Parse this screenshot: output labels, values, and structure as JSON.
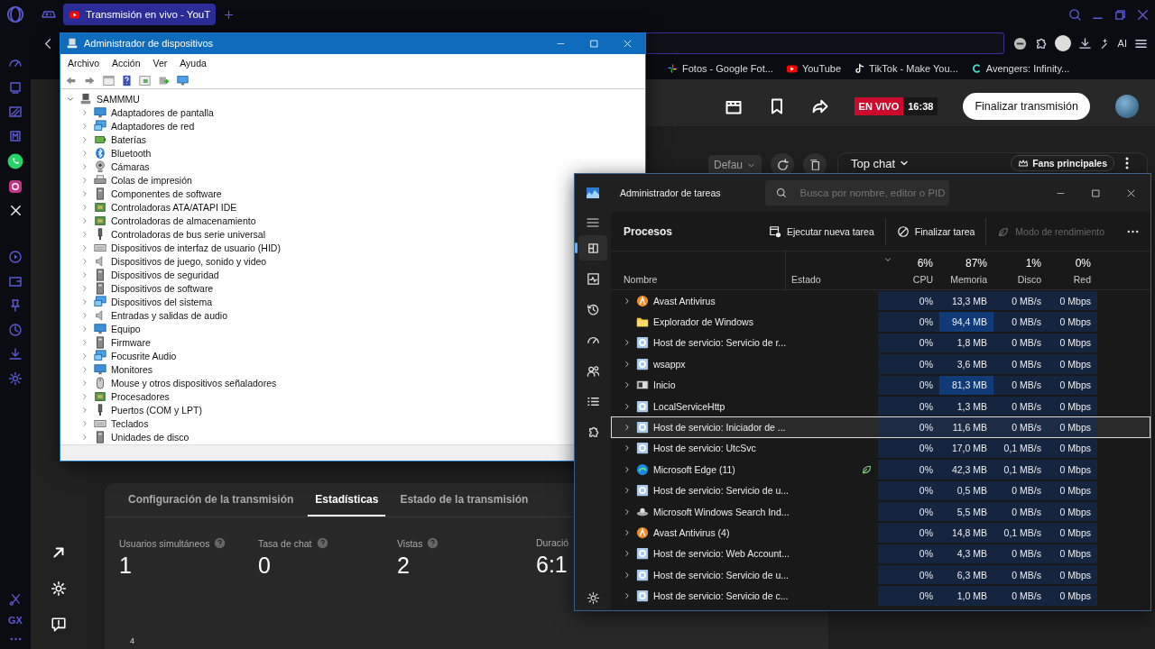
{
  "browser": {
    "tabs": [
      {
        "label": "Transmisión en vivo - YouT",
        "selected": true
      }
    ],
    "bookmarks": [
      {
        "label": "Fotos - Google Fot...",
        "kind": "photos"
      },
      {
        "label": "YouTube",
        "kind": "video"
      },
      {
        "label": "TikTok - Make You...",
        "kind": "note"
      },
      {
        "label": "Avengers: Infinity...",
        "kind": "letter"
      }
    ],
    "ai_label": "AI",
    "sidebar_label": "GX"
  },
  "studio": {
    "live_badge": "EN VIVO",
    "live_time": "16:38",
    "end_button": "Finalizar transmisión",
    "preview_select": "Defau",
    "chat_mode": "Top chat",
    "chat_filter": "Fans principales",
    "tabs": [
      {
        "label": "Configuración de la transmisión",
        "selected": false
      },
      {
        "label": "Estadísticas",
        "selected": true
      },
      {
        "label": "Estado de la transmisión",
        "selected": false
      }
    ],
    "stats": [
      {
        "label": "Usuarios simultáneos",
        "value": "1",
        "help": true
      },
      {
        "label": "Tasa de chat",
        "value": "0",
        "help": true
      },
      {
        "label": "Vistas",
        "value": "2",
        "help": true
      },
      {
        "label": "Duració",
        "value": "6:1",
        "help": false
      }
    ],
    "chart_tick": "4"
  },
  "device_manager": {
    "title": "Administrador de dispositivos",
    "menu": [
      "Archivo",
      "Acción",
      "Ver",
      "Ayuda"
    ],
    "tree": {
      "label": "SAMMMU",
      "expanded": true,
      "children": [
        {
          "label": "Adaptadores de pantalla",
          "kind": "monitor",
          "expanded": false
        },
        {
          "label": "Adaptadores de red",
          "kind": "network",
          "expanded": false
        },
        {
          "label": "Baterías",
          "kind": "battery",
          "expanded": false
        },
        {
          "label": "Bluetooth",
          "kind": "bluetooth",
          "expanded": false
        },
        {
          "label": "Cámaras",
          "kind": "camera",
          "expanded": false
        },
        {
          "label": "Colas de impresión",
          "kind": "printer",
          "expanded": false
        },
        {
          "label": "Componentes de software",
          "kind": "box",
          "expanded": false
        },
        {
          "label": "Controladoras ATA/ATAPI IDE",
          "kind": "chip",
          "expanded": false
        },
        {
          "label": "Controladoras de almacenamiento",
          "kind": "chip",
          "expanded": false
        },
        {
          "label": "Controladoras de bus serie universal",
          "kind": "plug",
          "expanded": false
        },
        {
          "label": "Dispositivos de interfaz de usuario (HID)",
          "kind": "keyboard",
          "expanded": false
        },
        {
          "label": "Dispositivos de juego, sonido y video",
          "kind": "speaker",
          "expanded": false
        },
        {
          "label": "Dispositivos de seguridad",
          "kind": "box",
          "expanded": false
        },
        {
          "label": "Dispositivos de software",
          "kind": "box",
          "expanded": false
        },
        {
          "label": "Dispositivos del sistema",
          "kind": "network",
          "expanded": false
        },
        {
          "label": "Entradas y salidas de audio",
          "kind": "speaker",
          "expanded": false
        },
        {
          "label": "Equipo",
          "kind": "monitor",
          "expanded": false
        },
        {
          "label": "Firmware",
          "kind": "box",
          "expanded": false
        },
        {
          "label": "Focusrite Audio",
          "kind": "network",
          "expanded": false
        },
        {
          "label": "Monitores",
          "kind": "monitor",
          "expanded": false
        },
        {
          "label": "Mouse y otros dispositivos señaladores",
          "kind": "mouse",
          "expanded": false
        },
        {
          "label": "Procesadores",
          "kind": "chip",
          "expanded": false
        },
        {
          "label": "Puertos (COM y LPT)",
          "kind": "plug",
          "expanded": false
        },
        {
          "label": "Teclados",
          "kind": "keyboard",
          "expanded": false
        },
        {
          "label": "Unidades de disco",
          "kind": "box",
          "expanded": false
        }
      ]
    }
  },
  "task_manager": {
    "title": "Administrador de tareas",
    "search": {
      "placeholder": "Busca por nombre, editor o PID"
    },
    "nav": [
      {
        "kind": "processes",
        "selected": true
      },
      {
        "kind": "performance",
        "selected": false
      },
      {
        "kind": "history",
        "selected": false
      },
      {
        "kind": "startup",
        "selected": false
      },
      {
        "kind": "users",
        "selected": false
      },
      {
        "kind": "details",
        "selected": false
      },
      {
        "kind": "services",
        "selected": false
      }
    ],
    "page_title": "Procesos",
    "actions": [
      {
        "label": "Ejecutar nueva tarea",
        "kind": "run",
        "disabled": false
      },
      {
        "label": "Finalizar tarea",
        "kind": "end",
        "disabled": false
      },
      {
        "label": "Modo de rendimiento",
        "kind": "leaf",
        "disabled": true
      }
    ],
    "columns": {
      "name": "Nombre",
      "status": "Estado",
      "metrics": [
        {
          "label": "CPU",
          "total": "6%",
          "sorted": true
        },
        {
          "label": "Memoria",
          "total": "87%",
          "sorted": false
        },
        {
          "label": "Disco",
          "total": "1%",
          "sorted": false
        },
        {
          "label": "Red",
          "total": "0%",
          "sorted": false
        }
      ]
    },
    "processes": [
      {
        "name": "Avast Antivirus",
        "kind": "avast",
        "expandable": true,
        "eco": false,
        "selected": false,
        "memory_hot": false,
        "values": [
          "0%",
          "13,3 MB",
          "0 MB/s",
          "0 Mbps"
        ]
      },
      {
        "name": "Explorador de Windows",
        "kind": "folder",
        "expandable": false,
        "eco": false,
        "selected": false,
        "memory_hot": true,
        "values": [
          "0%",
          "94,4 MB",
          "0 MB/s",
          "0 Mbps"
        ]
      },
      {
        "name": "Host de servicio: Servicio de r...",
        "kind": "service",
        "expandable": true,
        "eco": false,
        "selected": false,
        "memory_hot": false,
        "values": [
          "0%",
          "1,8 MB",
          "0 MB/s",
          "0 Mbps"
        ]
      },
      {
        "name": "wsappx",
        "kind": "service",
        "expandable": true,
        "eco": false,
        "selected": false,
        "memory_hot": false,
        "values": [
          "0%",
          "3,6 MB",
          "0 MB/s",
          "0 Mbps"
        ]
      },
      {
        "name": "Inicio",
        "kind": "window",
        "expandable": true,
        "eco": false,
        "selected": false,
        "memory_hot": true,
        "values": [
          "0%",
          "81,3 MB",
          "0 MB/s",
          "0 Mbps"
        ]
      },
      {
        "name": "LocalServiceHttp",
        "kind": "service",
        "expandable": true,
        "eco": false,
        "selected": false,
        "memory_hot": false,
        "values": [
          "0%",
          "1,3 MB",
          "0 MB/s",
          "0 Mbps"
        ]
      },
      {
        "name": "Host de servicio: Iniciador de ...",
        "kind": "service",
        "expandable": true,
        "eco": false,
        "selected": true,
        "memory_hot": false,
        "values": [
          "0%",
          "11,6 MB",
          "0 MB/s",
          "0 Mbps"
        ]
      },
      {
        "name": "Host de servicio: UtcSvc",
        "kind": "service",
        "expandable": true,
        "eco": false,
        "selected": false,
        "memory_hot": false,
        "values": [
          "0%",
          "17,0 MB",
          "0,1 MB/s",
          "0 Mbps"
        ]
      },
      {
        "name": "Microsoft Edge (11)",
        "kind": "edge",
        "expandable": true,
        "eco": true,
        "selected": false,
        "memory_hot": false,
        "values": [
          "0%",
          "42,3 MB",
          "0,1 MB/s",
          "0 Mbps"
        ]
      },
      {
        "name": "Host de servicio: Servicio de u...",
        "kind": "service",
        "expandable": true,
        "eco": false,
        "selected": false,
        "memory_hot": false,
        "values": [
          "0%",
          "0,5 MB",
          "0 MB/s",
          "0 Mbps"
        ]
      },
      {
        "name": "Microsoft Windows Search Ind...",
        "kind": "search",
        "expandable": true,
        "eco": false,
        "selected": false,
        "memory_hot": false,
        "values": [
          "0%",
          "5,5 MB",
          "0 MB/s",
          "0 Mbps"
        ]
      },
      {
        "name": "Avast Antivirus (4)",
        "kind": "avast",
        "expandable": true,
        "eco": false,
        "selected": false,
        "memory_hot": false,
        "values": [
          "0%",
          "14,8 MB",
          "0,1 MB/s",
          "0 Mbps"
        ]
      },
      {
        "name": "Host de servicio: Web Account...",
        "kind": "service",
        "expandable": true,
        "eco": false,
        "selected": false,
        "memory_hot": false,
        "values": [
          "0%",
          "4,3 MB",
          "0 MB/s",
          "0 Mbps"
        ]
      },
      {
        "name": "Host de servicio: Servicio de u...",
        "kind": "service",
        "expandable": true,
        "eco": false,
        "selected": false,
        "memory_hot": false,
        "values": [
          "0%",
          "6,3 MB",
          "0 MB/s",
          "0 Mbps"
        ]
      },
      {
        "name": "Host de servicio: Servicio de c...",
        "kind": "service",
        "expandable": true,
        "eco": false,
        "selected": false,
        "memory_hot": false,
        "values": [
          "0%",
          "1,0 MB",
          "0 MB/s",
          "0 Mbps"
        ]
      }
    ]
  }
}
